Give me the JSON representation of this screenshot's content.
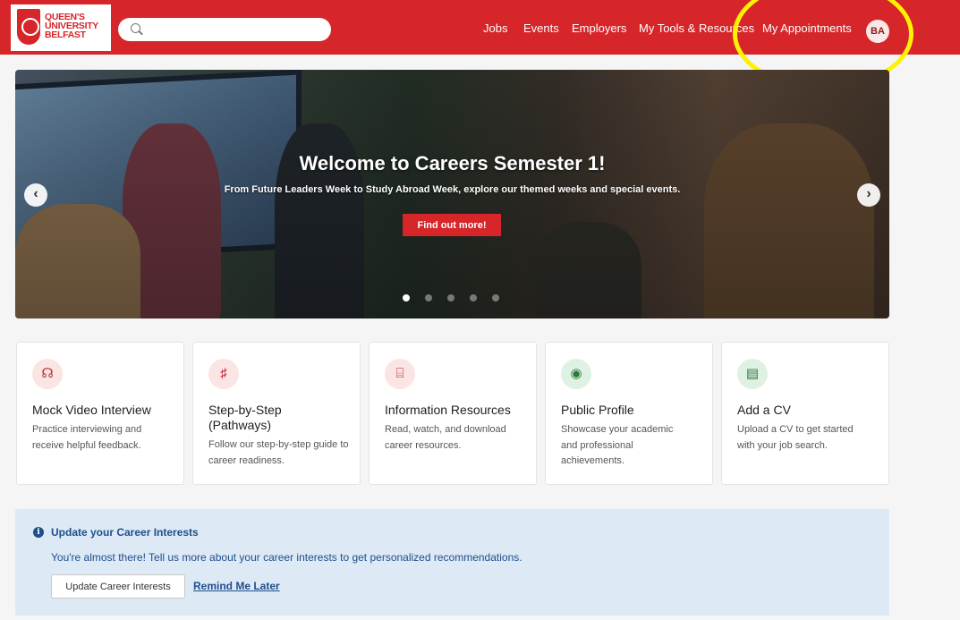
{
  "header": {
    "logo_lines": [
      "QUEEN'S",
      "UNIVERSITY",
      "BELFAST"
    ],
    "search": {
      "value": "",
      "placeholder": ""
    },
    "nav": [
      {
        "label": "Jobs"
      },
      {
        "label": "Events"
      },
      {
        "label": "Employers"
      },
      {
        "label": "My Tools & Resources"
      },
      {
        "label": "My Appointments"
      }
    ],
    "avatar_initials": "BA",
    "brand_color": "#d6262a",
    "highlight_color": "#fff200"
  },
  "hero": {
    "title": "Welcome to Careers Semester 1!",
    "subtitle": "From Future Leaders Week to Study Abroad Week, explore our themed weeks and special events.",
    "button_label": "Find out more!",
    "prev_glyph": "‹",
    "next_glyph": "›",
    "slide_count": 5,
    "active_slide": 1
  },
  "cards": [
    {
      "icon": "video-interview-icon",
      "icon_style": "red",
      "glyph": "☊",
      "title": "Mock Video Interview",
      "description": "Practice interviewing and receive helpful feedback."
    },
    {
      "icon": "ladder-icon",
      "icon_style": "red",
      "glyph": "♯",
      "title": "Step-by-Step (Pathways)",
      "description": "Follow our step-by-step guide to career readiness."
    },
    {
      "icon": "gift-box-icon",
      "icon_style": "red",
      "glyph": "⌸",
      "title": "Information Resources",
      "description": "Read, watch, and download career resources."
    },
    {
      "icon": "profile-icon",
      "icon_style": "green",
      "glyph": "◉",
      "title": "Public Profile",
      "description": "Showcase your academic and professional achievements."
    },
    {
      "icon": "document-icon",
      "icon_style": "green",
      "glyph": "▤",
      "title": "Add a CV",
      "description": "Upload a CV to get started with your job search."
    }
  ],
  "banner": {
    "info_glyph": "i",
    "title": "Update your Career Interests",
    "text": "You're almost there! Tell us more about your career interests to get personalized recommendations.",
    "primary_button": "Update Career Interests",
    "secondary_link": "Remind Me Later",
    "text_color": "#1e4f8c",
    "background": "#dde9f5"
  }
}
